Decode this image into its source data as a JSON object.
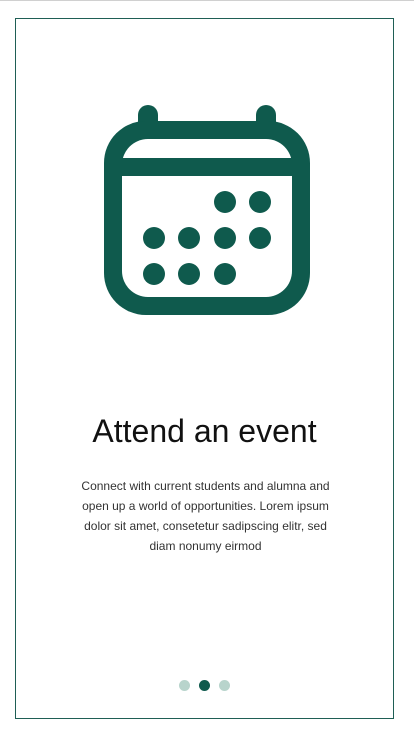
{
  "colors": {
    "accent": "#0f5a4d",
    "dot_inactive": "#b8d4cc",
    "frame_border": "#1f5e55"
  },
  "hero": {
    "icon": "calendar-icon"
  },
  "content": {
    "title": "Attend an event",
    "description": "Connect with current students and alumna and open up a world of opportunities. Lorem ipsum dolor sit amet, consetetur sadipscing elitr, sed diam nonumy eirmod"
  },
  "pager": {
    "total": 3,
    "active_index": 1
  }
}
